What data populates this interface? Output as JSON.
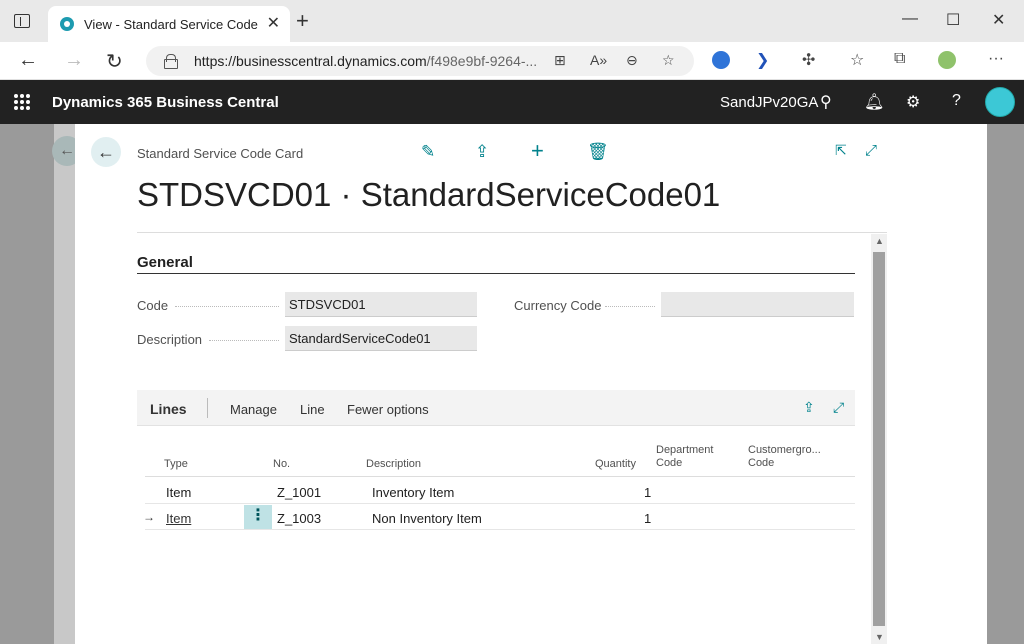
{
  "browser": {
    "tab_title": "View - Standard Service Code Ca",
    "url_host": "https://businesscentral.dynamics.com",
    "url_path": "/f498e9bf-9264-..."
  },
  "app": {
    "title": "Dynamics 365 Business Central",
    "company": "SandJPv20GA"
  },
  "card": {
    "caption": "Standard Service Code Card",
    "title": "STDSVCD01 · StandardServiceCode01",
    "general": {
      "section_title": "General",
      "code_label": "Code",
      "code_value": "STDSVCD01",
      "description_label": "Description",
      "description_value": "StandardServiceCode01",
      "currency_label": "Currency Code",
      "currency_value": ""
    },
    "lines": {
      "title": "Lines",
      "menu": [
        "Manage",
        "Line",
        "Fewer options"
      ],
      "columns": {
        "type": "Type",
        "no": "No.",
        "description": "Description",
        "quantity": "Quantity",
        "department_1": "Department",
        "department_2": "Code",
        "customergroup_1": "Customergro...",
        "customergroup_2": "Code"
      },
      "rows": [
        {
          "type": "Item",
          "no": "Z_1001",
          "description": "Inventory Item",
          "quantity": "1"
        },
        {
          "type": "Item",
          "no": "Z_1003",
          "description": "Non Inventory Item",
          "quantity": "1"
        }
      ]
    }
  },
  "colors": {
    "accent": "#00828c",
    "header_bg": "#222222"
  }
}
